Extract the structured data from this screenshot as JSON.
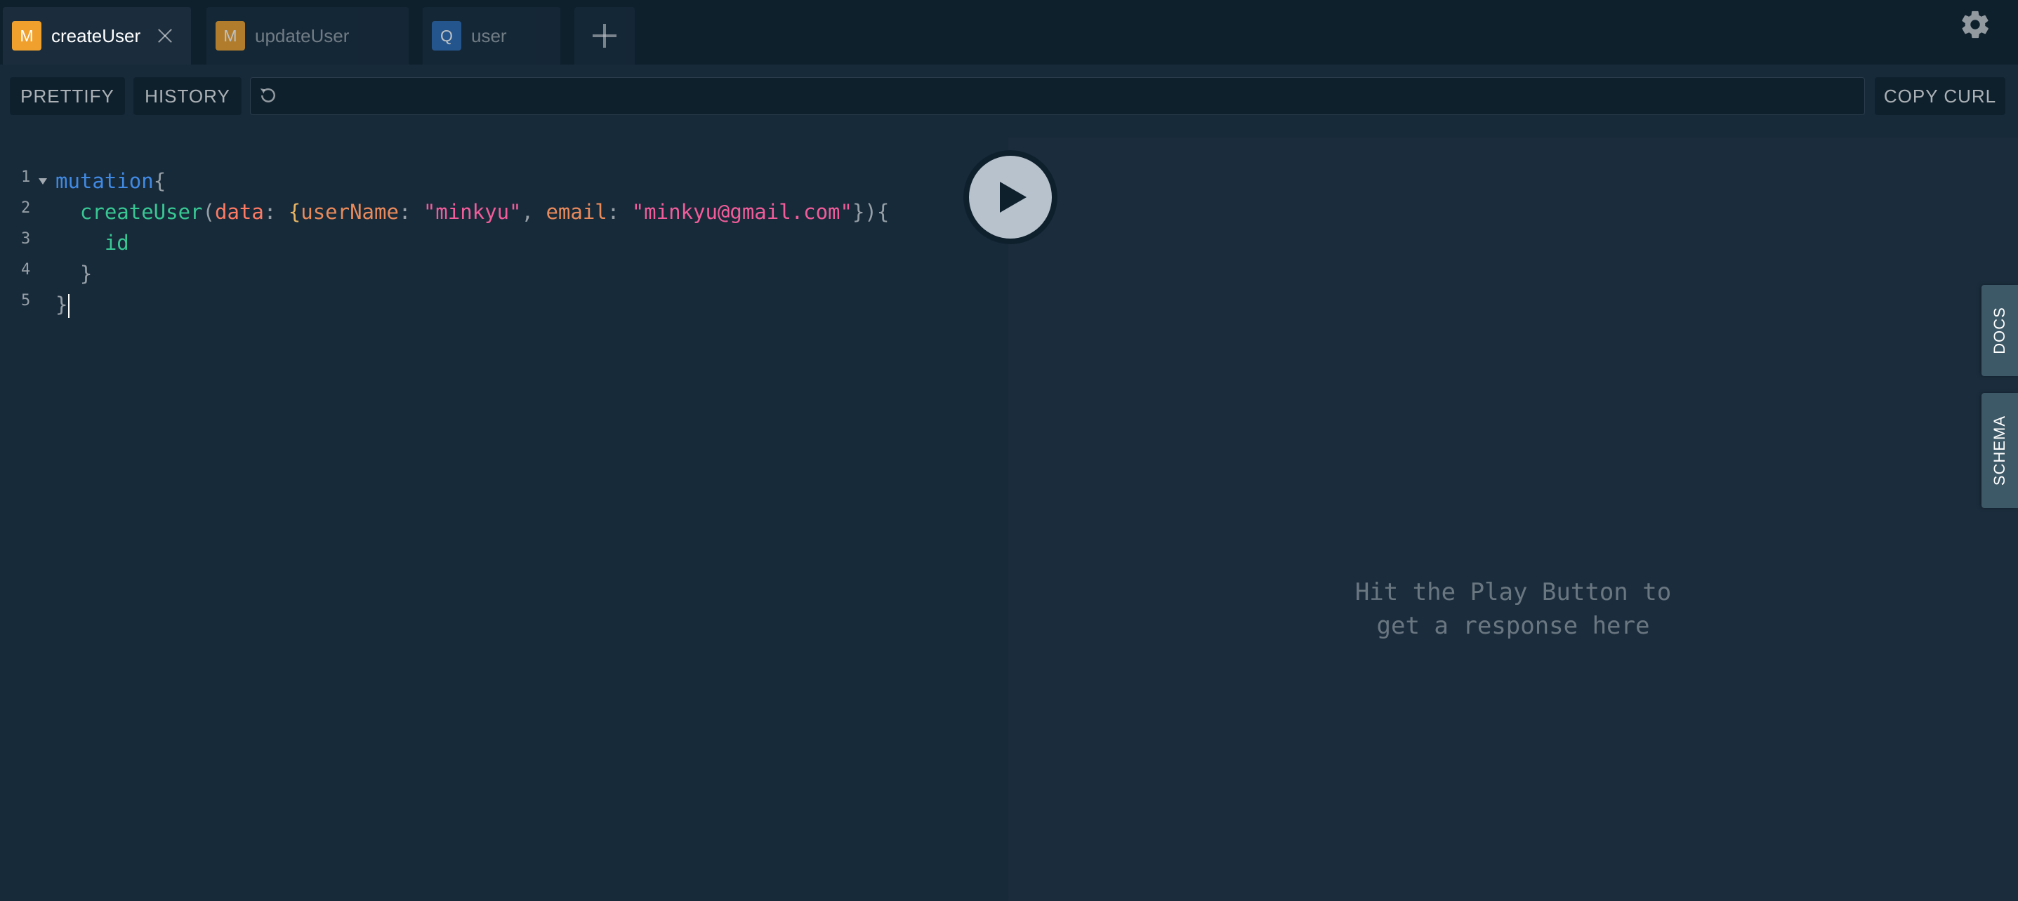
{
  "tabs": [
    {
      "badge": "M",
      "label": "createUser",
      "active": true,
      "badge_color": "#f0a12d"
    },
    {
      "badge": "M",
      "label": "updateUser",
      "active": false,
      "badge_color": "#f0a12d"
    },
    {
      "badge": "Q",
      "label": "user",
      "active": false,
      "badge_color": "#2e6ab3"
    }
  ],
  "toolbar": {
    "prettify_label": "PRETTIFY",
    "history_label": "HISTORY",
    "copy_curl_label": "COPY CURL",
    "endpoint_url": ""
  },
  "editor": {
    "line_numbers": [
      "1",
      "2",
      "3",
      "4",
      "5"
    ],
    "line1": {
      "keyword": "mutation",
      "brace": "{"
    },
    "line2": {
      "indent": "  ",
      "field": "createUser",
      "open": "(",
      "arg": "data",
      "colon1": ": ",
      "obj_open": "{",
      "key1": "userName",
      "colon2": ": ",
      "val1": "\"minkyu\"",
      "comma": ", ",
      "key2": "email",
      "colon3": ": ",
      "val2": "\"minkyu@gmail.com\"",
      "close": "})",
      "brace": "{"
    },
    "line3": {
      "indent": "    ",
      "field": "id"
    },
    "line4": {
      "indent": "  ",
      "brace": "}"
    },
    "line5": {
      "brace": "}"
    }
  },
  "result": {
    "placeholder_line1": "Hit the Play Button to",
    "placeholder_line2": "get a response here"
  },
  "side_tabs": {
    "docs_label": "DOCS",
    "schema_label": "SCHEMA"
  },
  "icons": {
    "settings": "gear-icon",
    "play": "play-icon",
    "add_tab": "plus-icon",
    "close_tab": "close-icon",
    "reload": "reload-icon"
  }
}
